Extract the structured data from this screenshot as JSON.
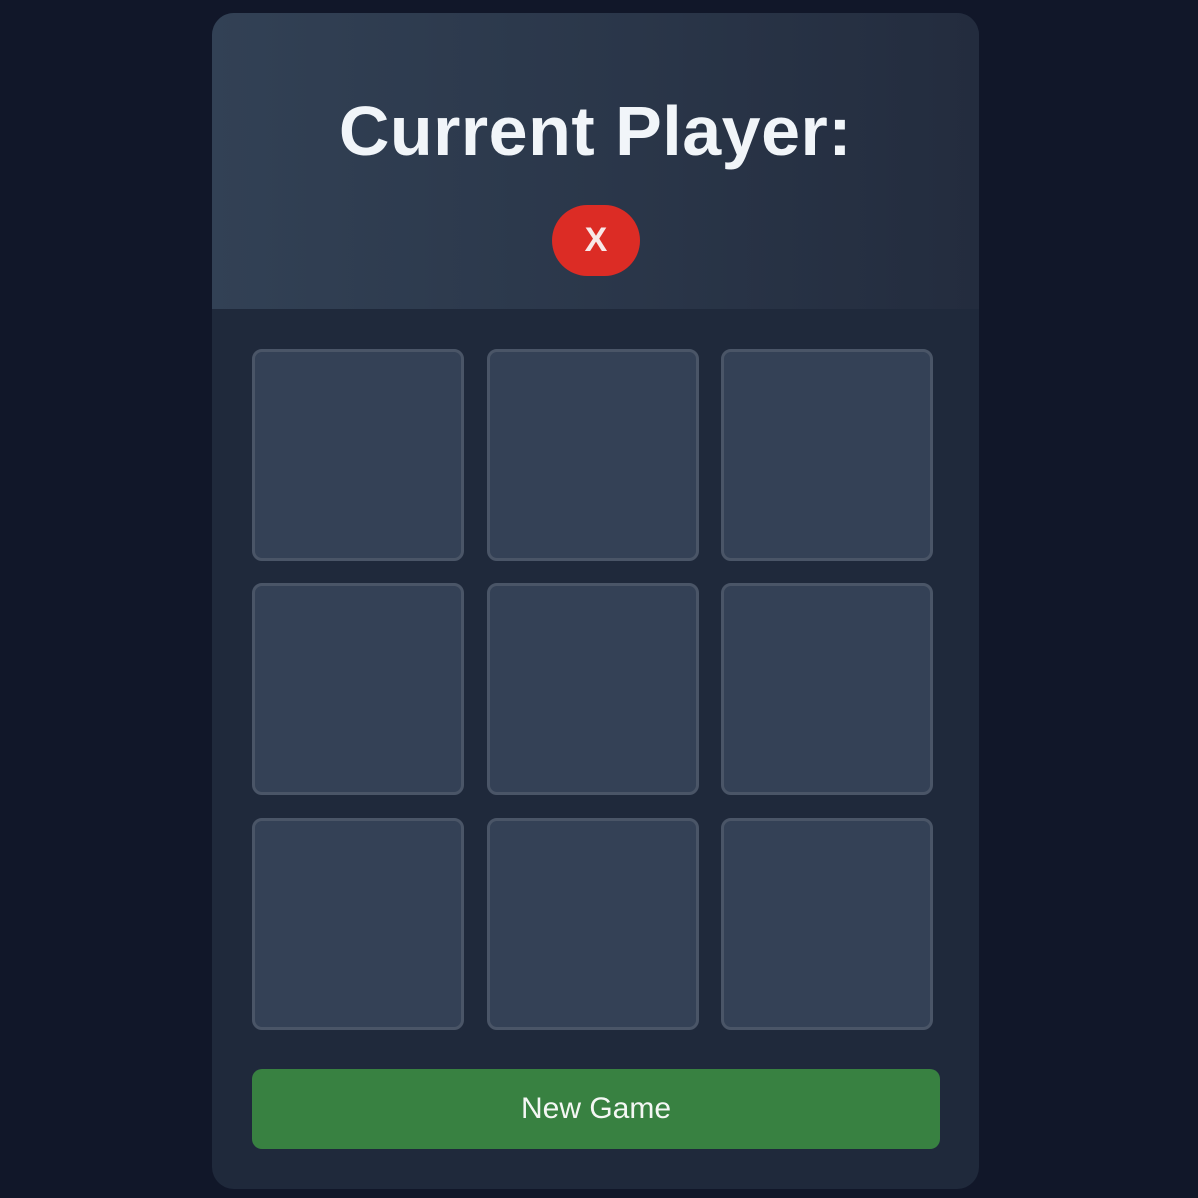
{
  "header": {
    "title": "Current Player:",
    "current_player": "X"
  },
  "board": {
    "cells": [
      "",
      "",
      "",
      "",
      "",
      "",
      "",
      "",
      ""
    ]
  },
  "actions": {
    "new_game_label": "New Game"
  },
  "colors": {
    "background": "#111729",
    "card": "#1f293b",
    "cell": "#344156",
    "player_x_badge": "#dc2c25",
    "new_game_button": "#388141"
  }
}
